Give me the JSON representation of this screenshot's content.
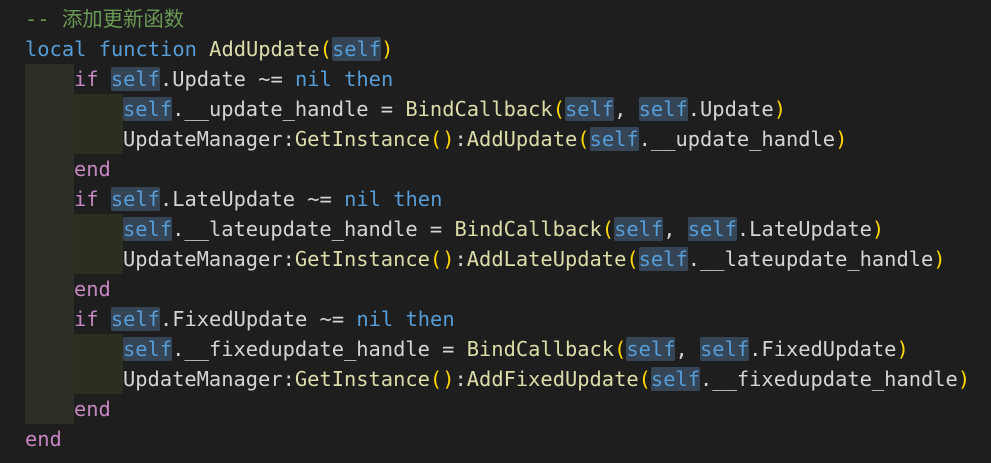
{
  "editor": {
    "colors": {
      "background": "#1e1e1e",
      "comment": "#6a9955",
      "keyword": "#569cd6",
      "control": "#c586c0",
      "function": "#dcdcaa",
      "text": "#d4d4d4",
      "paren_level1": "#ffd700",
      "paren_level2": "#da70d6",
      "self_highlight": "#364556",
      "indent_guide": "#2c2f25"
    },
    "lines": [
      {
        "indent": 0,
        "tokens": [
          {
            "t": "-- 添加更新函数",
            "c": "comment"
          }
        ]
      },
      {
        "indent": 0,
        "tokens": [
          {
            "t": "local",
            "c": "kw"
          },
          {
            "t": " ",
            "c": "ident"
          },
          {
            "t": "function",
            "c": "kw"
          },
          {
            "t": " ",
            "c": "ident"
          },
          {
            "t": "AddUpdate",
            "c": "fn"
          },
          {
            "t": "(",
            "c": "paren1"
          },
          {
            "t": "self",
            "c": "self"
          },
          {
            "t": ")",
            "c": "paren1"
          }
        ]
      },
      {
        "indent": 1,
        "tokens": [
          {
            "t": "if",
            "c": "ctl"
          },
          {
            "t": " ",
            "c": "ident"
          },
          {
            "t": "self",
            "c": "self"
          },
          {
            "t": ".Update ~= ",
            "c": "ident"
          },
          {
            "t": "nil",
            "c": "kw"
          },
          {
            "t": " ",
            "c": "ident"
          },
          {
            "t": "then",
            "c": "kw"
          }
        ]
      },
      {
        "indent": 2,
        "tokens": [
          {
            "t": "self",
            "c": "self"
          },
          {
            "t": ".__update_handle = ",
            "c": "ident"
          },
          {
            "t": "BindCallback",
            "c": "fn"
          },
          {
            "t": "(",
            "c": "paren1"
          },
          {
            "t": "self",
            "c": "self"
          },
          {
            "t": ", ",
            "c": "ident"
          },
          {
            "t": "self",
            "c": "self"
          },
          {
            "t": ".Update",
            "c": "ident"
          },
          {
            "t": ")",
            "c": "paren1"
          }
        ]
      },
      {
        "indent": 2,
        "tokens": [
          {
            "t": "UpdateManager:",
            "c": "ident"
          },
          {
            "t": "GetInstance",
            "c": "fn"
          },
          {
            "t": "()",
            "c": "paren1"
          },
          {
            "t": ":",
            "c": "ident"
          },
          {
            "t": "AddUpdate",
            "c": "fn"
          },
          {
            "t": "(",
            "c": "paren1"
          },
          {
            "t": "self",
            "c": "self"
          },
          {
            "t": ".__update_handle",
            "c": "ident"
          },
          {
            "t": ")",
            "c": "paren1"
          }
        ]
      },
      {
        "indent": 1,
        "tokens": [
          {
            "t": "end",
            "c": "ctl"
          }
        ]
      },
      {
        "indent": 1,
        "tokens": [
          {
            "t": "if",
            "c": "ctl"
          },
          {
            "t": " ",
            "c": "ident"
          },
          {
            "t": "self",
            "c": "self"
          },
          {
            "t": ".LateUpdate ~= ",
            "c": "ident"
          },
          {
            "t": "nil",
            "c": "kw"
          },
          {
            "t": " ",
            "c": "ident"
          },
          {
            "t": "then",
            "c": "kw"
          }
        ]
      },
      {
        "indent": 2,
        "tokens": [
          {
            "t": "self",
            "c": "self"
          },
          {
            "t": ".__lateupdate_handle = ",
            "c": "ident"
          },
          {
            "t": "BindCallback",
            "c": "fn"
          },
          {
            "t": "(",
            "c": "paren1"
          },
          {
            "t": "self",
            "c": "self"
          },
          {
            "t": ", ",
            "c": "ident"
          },
          {
            "t": "self",
            "c": "self"
          },
          {
            "t": ".LateUpdate",
            "c": "ident"
          },
          {
            "t": ")",
            "c": "paren1"
          }
        ]
      },
      {
        "indent": 2,
        "tokens": [
          {
            "t": "UpdateManager:",
            "c": "ident"
          },
          {
            "t": "GetInstance",
            "c": "fn"
          },
          {
            "t": "()",
            "c": "paren1"
          },
          {
            "t": ":",
            "c": "ident"
          },
          {
            "t": "AddLateUpdate",
            "c": "fn"
          },
          {
            "t": "(",
            "c": "paren1"
          },
          {
            "t": "self",
            "c": "self"
          },
          {
            "t": ".__lateupdate_handle",
            "c": "ident"
          },
          {
            "t": ")",
            "c": "paren1"
          }
        ]
      },
      {
        "indent": 1,
        "tokens": [
          {
            "t": "end",
            "c": "ctl"
          }
        ]
      },
      {
        "indent": 1,
        "tokens": [
          {
            "t": "if",
            "c": "ctl"
          },
          {
            "t": " ",
            "c": "ident"
          },
          {
            "t": "self",
            "c": "self"
          },
          {
            "t": ".FixedUpdate ~= ",
            "c": "ident"
          },
          {
            "t": "nil",
            "c": "kw"
          },
          {
            "t": " ",
            "c": "ident"
          },
          {
            "t": "then",
            "c": "kw"
          }
        ]
      },
      {
        "indent": 2,
        "tokens": [
          {
            "t": "self",
            "c": "self"
          },
          {
            "t": ".__fixedupdate_handle = ",
            "c": "ident"
          },
          {
            "t": "BindCallback",
            "c": "fn"
          },
          {
            "t": "(",
            "c": "paren1"
          },
          {
            "t": "self",
            "c": "self"
          },
          {
            "t": ", ",
            "c": "ident"
          },
          {
            "t": "self",
            "c": "self"
          },
          {
            "t": ".FixedUpdate",
            "c": "ident"
          },
          {
            "t": ")",
            "c": "paren1"
          }
        ]
      },
      {
        "indent": 2,
        "tokens": [
          {
            "t": "UpdateManager:",
            "c": "ident"
          },
          {
            "t": "GetInstance",
            "c": "fn"
          },
          {
            "t": "()",
            "c": "paren1"
          },
          {
            "t": ":",
            "c": "ident"
          },
          {
            "t": "AddFixedUpdate",
            "c": "fn"
          },
          {
            "t": "(",
            "c": "paren1"
          },
          {
            "t": "self",
            "c": "self"
          },
          {
            "t": ".__fixedupdate_handle",
            "c": "ident"
          },
          {
            "t": ")",
            "c": "paren1"
          }
        ]
      },
      {
        "indent": 1,
        "tokens": [
          {
            "t": "end",
            "c": "ctl"
          }
        ]
      },
      {
        "indent": 0,
        "tokens": [
          {
            "t": "end",
            "c": "ctl"
          }
        ]
      }
    ]
  }
}
